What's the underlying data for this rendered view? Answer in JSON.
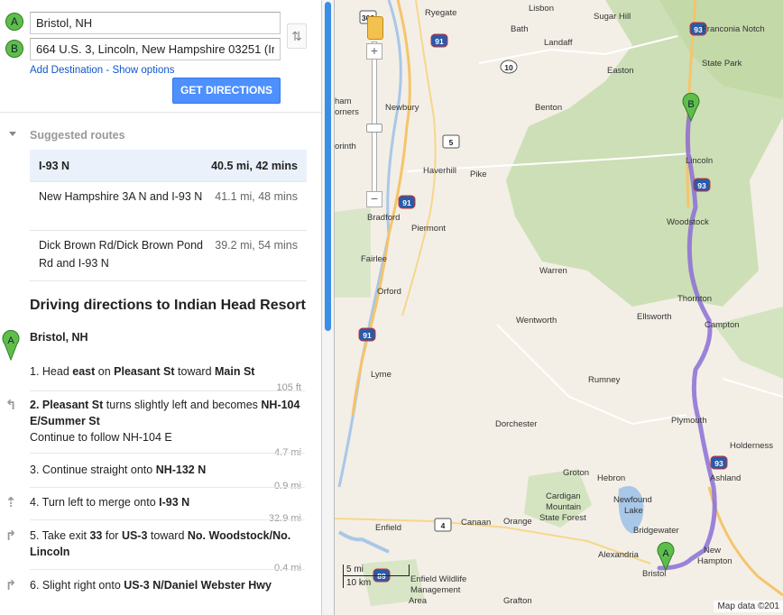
{
  "form": {
    "origin_marker": "A",
    "origin_value": "Bristol, NH",
    "destination_marker": "B",
    "destination_value": "664 U.S. 3, Lincoln, New Hampshire 03251 (In",
    "swap_glyph": "⇅",
    "add_destination": "Add Destination",
    "separator": " - ",
    "show_options": "Show options",
    "get_directions": "GET DIRECTIONS"
  },
  "suggested": {
    "title": "Suggested routes",
    "routes": [
      {
        "name": "I-93 N",
        "stats": "40.5 mi, 42 mins",
        "selected": true
      },
      {
        "name": "New Hampshire 3A N and I-93 N",
        "stats": "41.1 mi, 48 mins",
        "selected": false
      },
      {
        "name": "Dick Brown Rd/Dick Brown Pond Rd and I-93 N",
        "stats": "39.2 mi, 54 mins",
        "selected": false
      }
    ]
  },
  "directions": {
    "heading": "Driving directions to Indian Head Resort",
    "start_marker": "A",
    "start_label": "Bristol, NH",
    "steps": [
      {
        "parts": [
          [
            "1. "
          ],
          [
            "Head "
          ],
          [
            "east",
            "b"
          ],
          [
            " on "
          ],
          [
            "Pleasant St",
            "b"
          ],
          [
            " toward "
          ],
          [
            "Main St",
            "b"
          ]
        ],
        "dist": "105 ft",
        "icon": ""
      },
      {
        "parts": [
          [
            "2. Pleasant St",
            "b"
          ],
          [
            " turns slightly left and becomes "
          ],
          [
            "NH-104 E/Summer St",
            "b"
          ]
        ],
        "sub": "Continue to follow NH-104 E",
        "dist": "4.7 mi",
        "icon": "↰"
      },
      {
        "parts": [
          [
            "3. "
          ],
          [
            "Continue straight onto "
          ],
          [
            "NH-132 N",
            "b"
          ]
        ],
        "dist": "0.9 mi",
        "icon": ""
      },
      {
        "parts": [
          [
            "4. "
          ],
          [
            "Turn left to merge onto "
          ],
          [
            "I-93 N",
            "b"
          ]
        ],
        "dist": "32.9 mi",
        "icon": "⇡"
      },
      {
        "parts": [
          [
            "5. "
          ],
          [
            "Take exit "
          ],
          [
            "33",
            "b"
          ],
          [
            " for "
          ],
          [
            "US-3",
            "b"
          ],
          [
            " toward "
          ],
          [
            "No. Woodstock/No. Lincoln",
            "b"
          ]
        ],
        "dist": "0.4 mi",
        "icon": "↱"
      },
      {
        "parts": [
          [
            "6. "
          ],
          [
            "Slight right onto "
          ],
          [
            "US-3 N/Daniel Webster Hwy",
            "b"
          ]
        ],
        "dist": "",
        "icon": "↱"
      }
    ]
  },
  "map": {
    "places": [
      [
        "Ryegate",
        100,
        8
      ],
      [
        "Lisbon",
        215,
        3
      ],
      [
        "Sugar Hill",
        287,
        12
      ],
      [
        "Bath",
        195,
        26
      ],
      [
        "Landaff",
        232,
        41
      ],
      [
        "Franconia Notch",
        407,
        26
      ],
      [
        "State Park",
        407,
        64
      ],
      [
        "Easton",
        302,
        72
      ],
      [
        "Newbury",
        56,
        113
      ],
      [
        "Benton",
        222,
        113
      ],
      [
        "ham",
        0,
        106
      ],
      [
        "orners",
        0,
        118
      ],
      [
        "orinth",
        0,
        156
      ],
      [
        "Haverhill",
        98,
        183
      ],
      [
        "Pike",
        150,
        187
      ],
      [
        "Lincoln",
        389,
        172
      ],
      [
        "Bradford",
        36,
        235
      ],
      [
        "Woodstock",
        368,
        240
      ],
      [
        "Piermont",
        85,
        247
      ],
      [
        "Fairlee",
        29,
        281
      ],
      [
        "Warren",
        227,
        294
      ],
      [
        "Orford",
        47,
        317
      ],
      [
        "Thornton",
        380,
        325
      ],
      [
        "Ellsworth",
        335,
        345
      ],
      [
        "Campton",
        410,
        354
      ],
      [
        "Wentworth",
        201,
        349
      ],
      [
        "Lyme",
        40,
        409
      ],
      [
        "Rumney",
        281,
        415
      ],
      [
        "Dorchester",
        178,
        464
      ],
      [
        "Plymouth",
        373,
        460
      ],
      [
        "Holderness",
        438,
        488
      ],
      [
        "Groton",
        253,
        518
      ],
      [
        "Hebron",
        291,
        524
      ],
      [
        "Ashland",
        416,
        524
      ],
      [
        "Cardigan",
        234,
        544
      ],
      [
        "Mountain",
        234,
        556
      ],
      [
        "State Forest",
        227,
        568
      ],
      [
        "Newfound",
        309,
        548
      ],
      [
        "Lake",
        321,
        560
      ],
      [
        "Enfield",
        45,
        579
      ],
      [
        "Canaan",
        140,
        573
      ],
      [
        "Orange",
        187,
        572
      ],
      [
        "Bridgewater",
        331,
        582
      ],
      [
        "Alexandria",
        292,
        609
      ],
      [
        "New",
        409,
        604
      ],
      [
        "Hampton",
        402,
        616
      ],
      [
        "Bristol",
        341,
        630
      ],
      [
        "Enfield Wildlife",
        84,
        636
      ],
      [
        "Management",
        84,
        648
      ],
      [
        "Area",
        82,
        660
      ],
      [
        "Grafton",
        187,
        660
      ]
    ],
    "shields": [
      [
        "302",
        28,
        12,
        "us"
      ],
      [
        "93",
        394,
        25,
        "i"
      ],
      [
        "91",
        107,
        38,
        "i"
      ],
      [
        "10",
        184,
        67,
        "st"
      ],
      [
        "5",
        120,
        150,
        "us"
      ],
      [
        "91",
        71,
        217,
        "i"
      ],
      [
        "93",
        398,
        198,
        "i"
      ],
      [
        "91",
        27,
        364,
        "i"
      ],
      [
        "93",
        417,
        506,
        "i"
      ],
      [
        "4",
        111,
        575,
        "us"
      ],
      [
        "89",
        43,
        631,
        "i"
      ]
    ],
    "pin_a": "A",
    "pin_b": "B",
    "zoom_plus": "+",
    "zoom_minus": "−",
    "scale_mi": "5 mi",
    "scale_km": "10 km",
    "attribution": "Map data ©201"
  }
}
